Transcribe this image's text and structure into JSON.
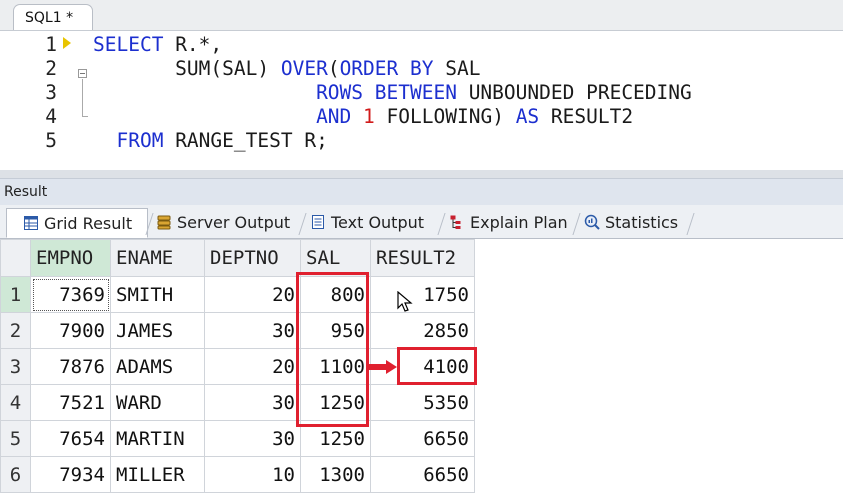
{
  "editor_tab": {
    "label": "SQL1 *"
  },
  "editor": {
    "line_numbers": [
      "1",
      "2",
      "3",
      "4",
      "5"
    ],
    "lines": [
      [
        {
          "t": "SELECT",
          "k": "kw"
        },
        {
          "t": " R.*,",
          "k": ""
        }
      ],
      [
        {
          "t": "       SUM(SAL) ",
          "k": ""
        },
        {
          "t": "OVER",
          "k": "kw"
        },
        {
          "t": "(",
          "k": ""
        },
        {
          "t": "ORDER BY",
          "k": "kw"
        },
        {
          "t": " SAL",
          "k": ""
        }
      ],
      [
        {
          "t": "                   ",
          "k": ""
        },
        {
          "t": "ROWS BETWEEN",
          "k": "kw"
        },
        {
          "t": " UNBOUNDED PRECEDING",
          "k": ""
        }
      ],
      [
        {
          "t": "                   ",
          "k": ""
        },
        {
          "t": "AND",
          "k": "kw"
        },
        {
          "t": " ",
          "k": ""
        },
        {
          "t": "1",
          "k": "num"
        },
        {
          "t": " FOLLOWING) ",
          "k": ""
        },
        {
          "t": "AS",
          "k": "kw"
        },
        {
          "t": " RESULT2",
          "k": ""
        }
      ],
      [
        {
          "t": "  ",
          "k": ""
        },
        {
          "t": "FROM",
          "k": "kw"
        },
        {
          "t": " RANGE_TEST R;",
          "k": ""
        }
      ]
    ]
  },
  "result_panel": {
    "title": "Result",
    "tabs": [
      {
        "label": "Grid Result",
        "icon": "grid-icon"
      },
      {
        "label": "Server Output",
        "icon": "server-output-icon"
      },
      {
        "label": "Text Output",
        "icon": "text-output-icon"
      },
      {
        "label": "Explain Plan",
        "icon": "explain-plan-icon"
      },
      {
        "label": "Statistics",
        "icon": "statistics-icon"
      }
    ]
  },
  "grid": {
    "columns": [
      "EMPNO",
      "ENAME",
      "DEPTNO",
      "SAL",
      "RESULT2"
    ],
    "rows": [
      {
        "n": "1",
        "cells": [
          "7369",
          "SMITH",
          "20",
          "800",
          "1750"
        ]
      },
      {
        "n": "2",
        "cells": [
          "7900",
          "JAMES",
          "30",
          "950",
          "2850"
        ]
      },
      {
        "n": "3",
        "cells": [
          "7876",
          "ADAMS",
          "20",
          "1100",
          "4100"
        ]
      },
      {
        "n": "4",
        "cells": [
          "7521",
          "WARD",
          "30",
          "1250",
          "5350"
        ]
      },
      {
        "n": "5",
        "cells": [
          "7654",
          "MARTIN",
          "30",
          "1250",
          "6650"
        ]
      },
      {
        "n": "6",
        "cells": [
          "7934",
          "MILLER",
          "10",
          "1300",
          "6650"
        ]
      }
    ]
  },
  "colors": {
    "keyword": "#1c2fcf",
    "number_literal": "#d11a1a",
    "annotation_red": "#e0202f",
    "selected_green": "#cfe8d6"
  }
}
